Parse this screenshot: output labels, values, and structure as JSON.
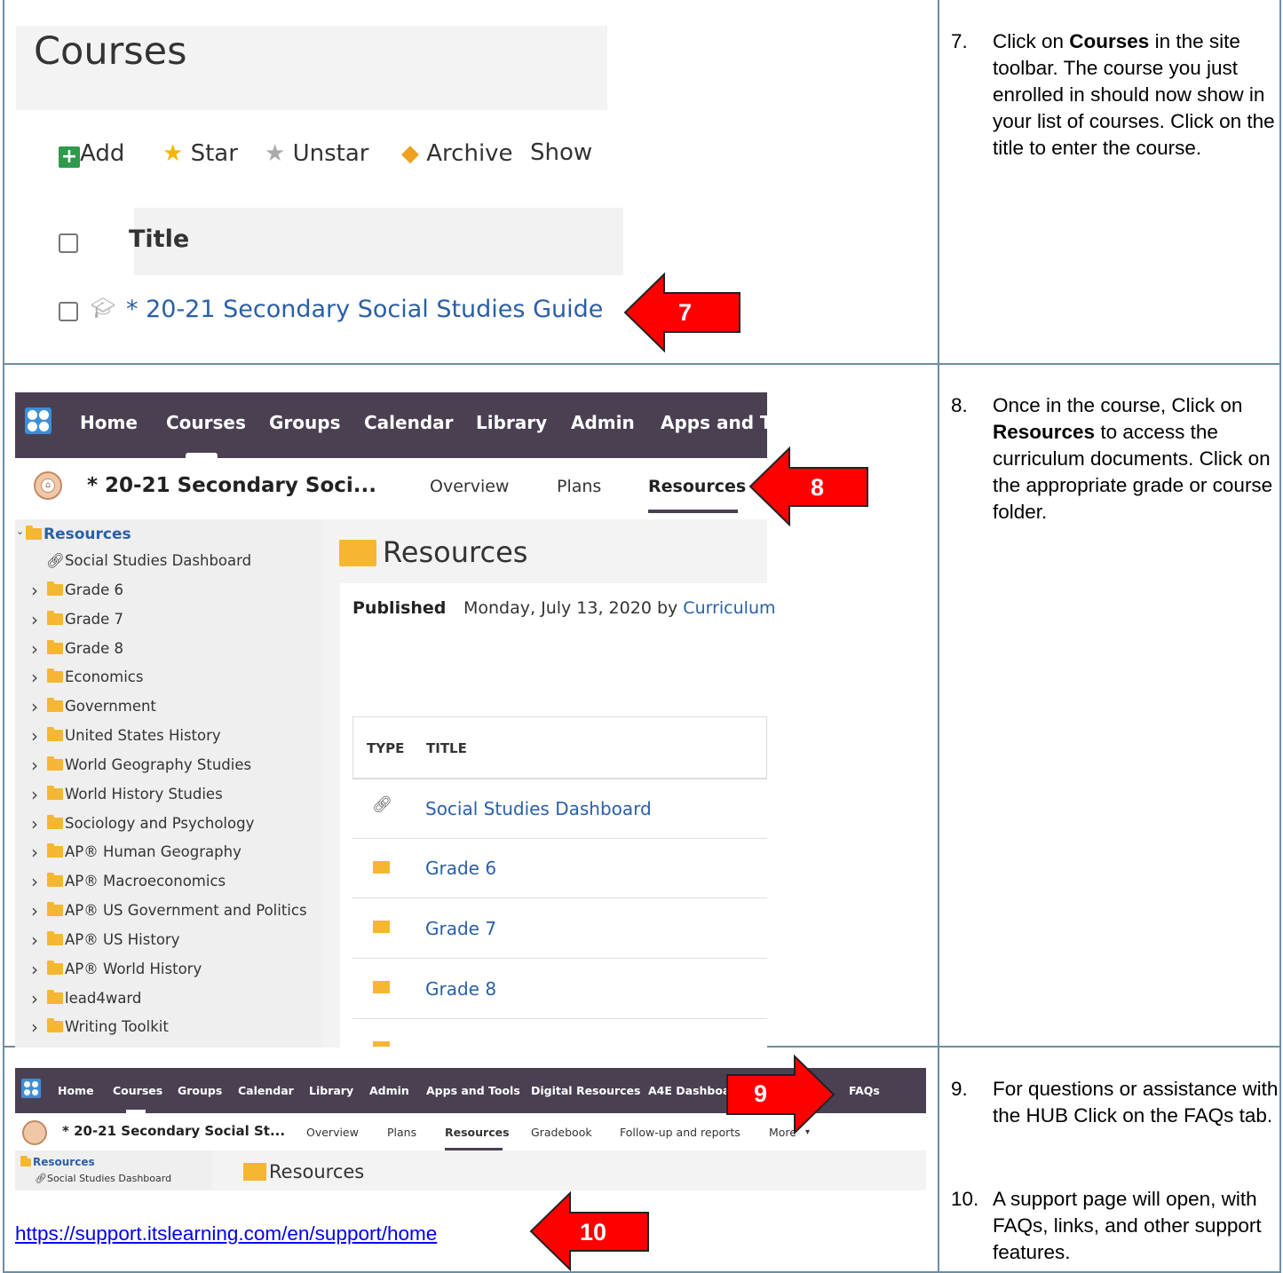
{
  "instructions": [
    {
      "num": "7.",
      "pre": "Click on ",
      "bold": "Courses",
      "post": " in the site toolbar. The course you just enrolled in should now show in your list of courses. Click on the title to enter the course."
    },
    {
      "num": "8.",
      "pre": "Once in the course, Click on ",
      "bold": "Resources",
      "post": " to access the curriculum documents. Click on the appropriate grade or course folder."
    },
    {
      "num": "9.",
      "pre": "For questions or assistance with the HUB Click on the FAQs tab.",
      "bold": "",
      "post": ""
    },
    {
      "num": "10.",
      "pre": "A support page will open, with FAQs, links, and other support features.",
      "bold": "",
      "post": ""
    }
  ],
  "arrows": {
    "a7": "7",
    "a8": "8",
    "a9": "9",
    "a10": "10"
  },
  "panel1": {
    "page_title": "Courses",
    "toolbar": {
      "add": "Add",
      "star": "Star",
      "unstar": "Unstar",
      "archive": "Archive",
      "show": "Show"
    },
    "column_title": "Title",
    "course_link": "* 20-21 Secondary Social Studies Guide"
  },
  "panel2": {
    "nav": [
      "Home",
      "Courses",
      "Groups",
      "Calendar",
      "Library",
      "Admin",
      "Apps and To"
    ],
    "course_title": "* 20-21 Secondary Soci...",
    "tabs": {
      "overview": "Overview",
      "plans": "Plans",
      "resources": "Resources"
    },
    "tree_root": "Resources",
    "tree_dashboard": "Social Studies Dashboard",
    "tree_folders": [
      "Grade 6",
      "Grade 7",
      "Grade 8",
      "Economics",
      "Government",
      "United States History",
      "World Geography Studies",
      "World History Studies",
      "Sociology and Psychology",
      "AP® Human Geography",
      "AP® Macroeconomics",
      "AP® US Government and Politics",
      "AP® US History",
      "AP® World History",
      "lead4ward",
      "Writing Toolkit"
    ],
    "heading": "Resources",
    "published_label": "Published",
    "published_text": "Monday, July 13, 2020 by",
    "published_by": "Curriculum",
    "col_type": "TYPE",
    "col_title": "TITLE",
    "rows": [
      "Social Studies Dashboard",
      "Grade 6",
      "Grade 7",
      "Grade 8"
    ]
  },
  "panel3": {
    "nav": [
      "Home",
      "Courses",
      "Groups",
      "Calendar",
      "Library",
      "Admin",
      "Apps and Tools",
      "Digital Resources",
      "A4E Dashboar",
      "FAQs"
    ],
    "course_title": "* 20-21 Secondary Social St...",
    "tabs": [
      "Overview",
      "Plans",
      "Resources",
      "Gradebook",
      "Follow-up and reports",
      "More"
    ],
    "tree_root": "Resources",
    "tree_dashboard": "Social Studies Dashboard",
    "heading": "Resources",
    "support_url": "https://support.itslearning.com/en/support/home"
  },
  "colors": {
    "arrow": "#ff0000",
    "nav": "#4a4052",
    "link": "#2a5fa8",
    "border": "#6d8ea3"
  }
}
